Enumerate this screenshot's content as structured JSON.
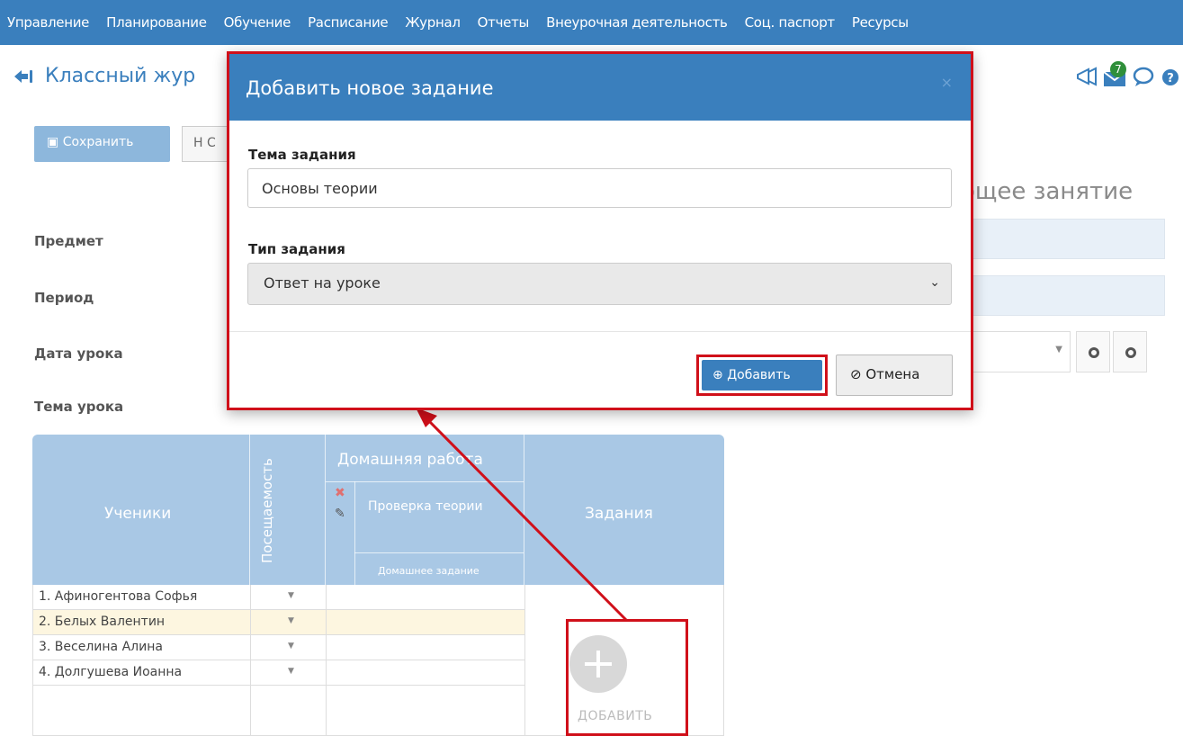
{
  "nav": [
    "Управление",
    "Планирование",
    "Обучение",
    "Расписание",
    "Журнал",
    "Отчеты",
    "Внеурочная деятельность",
    "Соц. паспорт",
    "Ресурсы"
  ],
  "header": {
    "title": "Классный жур",
    "badge": "7"
  },
  "toolbar": {
    "save": "Сохранить",
    "save2": "Н С"
  },
  "next_lesson": "ощее занятие",
  "form": {
    "subject": "Предмет",
    "period": "Период",
    "date": "Дата урока",
    "topic": "Тема урока"
  },
  "table": {
    "students_header": "Ученики",
    "attendance_header": "Посещаемость",
    "homework_header": "Домашняя работа",
    "theory_check": "Проверка теории",
    "homework_task": "Домашнее задание",
    "tasks_header": "Задания",
    "students": [
      "1. Афиногентова Софья",
      "2. Белых Валентин",
      "3. Веселина Алина",
      "4. Долгушева Иоанна"
    ],
    "add_label": "ДОБАВИТЬ"
  },
  "modal": {
    "title": "Добавить новое задание",
    "close": "×",
    "topic_label": "Тема задания",
    "topic_value": "Основы теории",
    "type_label": "Тип задания",
    "type_value": "Ответ на уроке",
    "add_button": "Добавить",
    "cancel_button": "Отмена"
  },
  "colors": {
    "primary": "#3a7fbd",
    "highlight": "#d0101a",
    "table_header": "#a9c8e5"
  }
}
